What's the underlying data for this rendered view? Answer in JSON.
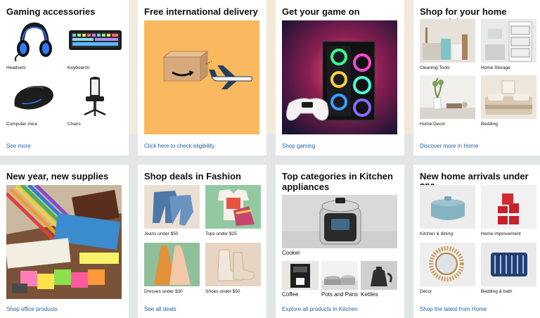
{
  "cards": {
    "gaming": {
      "title": "Gaming accessories",
      "items": [
        {
          "label": "Headsets"
        },
        {
          "label": "Keyboards"
        },
        {
          "label": "Computer mice"
        },
        {
          "label": "Chairs"
        }
      ],
      "link": "See more"
    },
    "delivery": {
      "title": "Free international delivery",
      "link": "Click here to check eligibility."
    },
    "game": {
      "title": "Get your game on",
      "link": "Shop gaming"
    },
    "home": {
      "title": "Shop for your home essentials",
      "items": [
        {
          "label": "Cleaning Tools"
        },
        {
          "label": "Home Storage"
        },
        {
          "label": "Home Decor"
        },
        {
          "label": "Bedding"
        }
      ],
      "link": "Discover more in Home"
    },
    "supplies": {
      "title": "New year, new supplies",
      "link": "Shop office products"
    },
    "fashion": {
      "title": "Shop deals in Fashion",
      "items": [
        {
          "label": "Jeans under $50"
        },
        {
          "label": "Tops under $25"
        },
        {
          "label": "Dresses under $30"
        },
        {
          "label": "Shoes under $50"
        }
      ],
      "link": "See all deals"
    },
    "kitchen": {
      "title": "Top categories in Kitchen appliances",
      "main_label": "Cooker",
      "items": [
        {
          "label": "Coffee"
        },
        {
          "label": "Pots and Pans"
        },
        {
          "label": "Kettles"
        }
      ],
      "link": "Explore all products in Kitchen"
    },
    "arrivals": {
      "title": "New home arrivals under $50",
      "items": [
        {
          "label": "Kitchen & dining"
        },
        {
          "label": "Home improvement"
        },
        {
          "label": "Décor"
        },
        {
          "label": "Bedding & bath"
        }
      ],
      "link": "Shop the latest from Home"
    }
  },
  "colors": {
    "link": "#2162a1",
    "title": "#0f1111",
    "delivery_bg": "#fbb95f",
    "page_bg": "#e3e6e6"
  }
}
